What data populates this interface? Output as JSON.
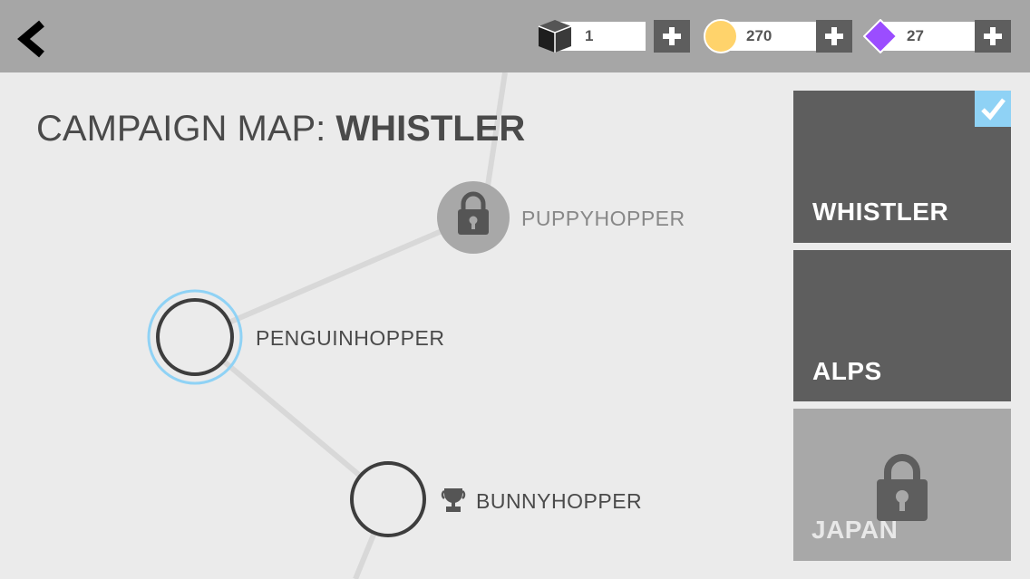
{
  "header": {
    "resources": [
      {
        "icon": "cube-icon",
        "value": "1"
      },
      {
        "icon": "coin-icon",
        "value": "270",
        "color": "#ffd36b"
      },
      {
        "icon": "gem-icon",
        "value": "27",
        "color": "#9b4dff"
      }
    ]
  },
  "title": {
    "prefix": "CAMPAIGN MAP: ",
    "map_name": "WHISTLER"
  },
  "levels": [
    {
      "name": "PUPPYHOPPER",
      "state": "locked"
    },
    {
      "name": "PENGUINHOPPER",
      "state": "selected"
    },
    {
      "name": "BUNNYHOPPER",
      "state": "completed",
      "badge": "trophy-icon"
    }
  ],
  "maps": [
    {
      "name": "WHISTLER",
      "state": "selected"
    },
    {
      "name": "ALPS",
      "state": "unlocked"
    },
    {
      "name": "JAPAN",
      "state": "locked"
    }
  ],
  "colors": {
    "accent": "#8fd2f5",
    "tile_dark": "#5e5e5e",
    "tile_locked": "#a8a8a8",
    "topbar": "#a6a6a6"
  }
}
